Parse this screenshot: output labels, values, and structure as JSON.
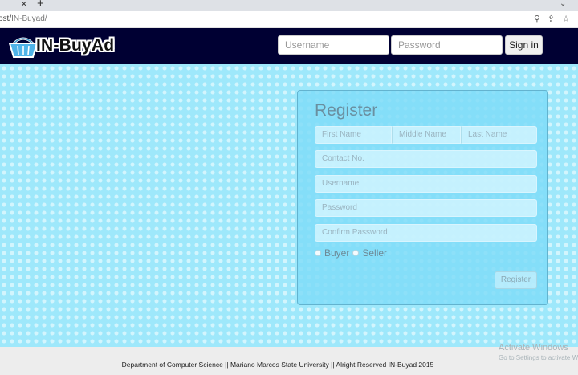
{
  "browser": {
    "tab_close_glyph": "×",
    "new_tab_glyph": "+",
    "url_prefix": "ost/",
    "url_path": "IN-Buyad/"
  },
  "header": {
    "logo_text": "IN-BuyAd",
    "username_placeholder": "Username",
    "password_placeholder": "Password",
    "signin_label": "Sign in"
  },
  "register": {
    "title": "Register",
    "first_name_placeholder": "First Name",
    "middle_name_placeholder": "Middle Name",
    "last_name_placeholder": "Last Name",
    "contact_placeholder": "Contact No.",
    "username_placeholder": "Username",
    "password_placeholder": "Password",
    "confirm_password_placeholder": "Confirm Password",
    "role_options": [
      "Buyer",
      "Seller"
    ],
    "submit_label": "Register"
  },
  "footer": {
    "text": "Department of Computer Science || Mariano Marcos State University || Alright Reserved IN-Buyad 2015"
  },
  "watermark": {
    "title": "Activate Windows",
    "subtitle": "Go to Settings to activate Windows."
  },
  "colors": {
    "header_bg": "#000033",
    "page_bg": "#9ee8fb",
    "footer_bg": "#ededed"
  },
  "icons": [
    "close-icon",
    "plus-icon",
    "chevron-down-icon",
    "zoom-icon",
    "share-icon",
    "star-icon",
    "basket-logo-icon"
  ]
}
